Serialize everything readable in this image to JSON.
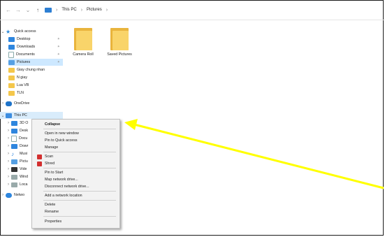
{
  "address_bar": {
    "back_icon": "arrow-left-icon",
    "forward_icon": "arrow-right-icon",
    "recent_icon": "chevron-down-icon",
    "up_icon": "arrow-up-icon",
    "crumbs": [
      "This PC",
      "Pictures"
    ]
  },
  "sidebar": {
    "quick_access": "Quick access",
    "items": [
      {
        "label": "Desktop"
      },
      {
        "label": "Downloads"
      },
      {
        "label": "Documents"
      },
      {
        "label": "Pictures"
      },
      {
        "label": "Giay chung nhan"
      },
      {
        "label": "N giay"
      },
      {
        "label": "Lua VB"
      },
      {
        "label": "TLN"
      }
    ],
    "onedrive": "OneDrive",
    "this_pc": "This PC",
    "pc_children": [
      "3D O",
      "Desk",
      "Docu",
      "Dowr",
      "Musi",
      "Pictu",
      "Vide",
      "Wind",
      "Loca"
    ],
    "network": "Netwo"
  },
  "content": {
    "folders": [
      {
        "name": "Camera Roll"
      },
      {
        "name": "Saved Pictures"
      }
    ]
  },
  "context_menu": {
    "items": [
      {
        "label": "Collapse",
        "bold": true
      },
      {
        "label": "Open in new window"
      },
      {
        "label": "Pin to Quick access"
      },
      {
        "label": "Manage"
      },
      {
        "label": "Scan"
      },
      {
        "label": "Shred"
      },
      {
        "label": "Pin to Start"
      },
      {
        "label": "Map network drive..."
      },
      {
        "label": "Disconnect network drive..."
      },
      {
        "label": "Add a network location"
      },
      {
        "label": "Delete"
      },
      {
        "label": "Rename"
      },
      {
        "label": "Properties"
      }
    ]
  },
  "colors": {
    "selection": "#cde8ff",
    "accent": "#2e86de",
    "folder": "#f9d46a",
    "annotation_arrow": "#ffff00"
  }
}
